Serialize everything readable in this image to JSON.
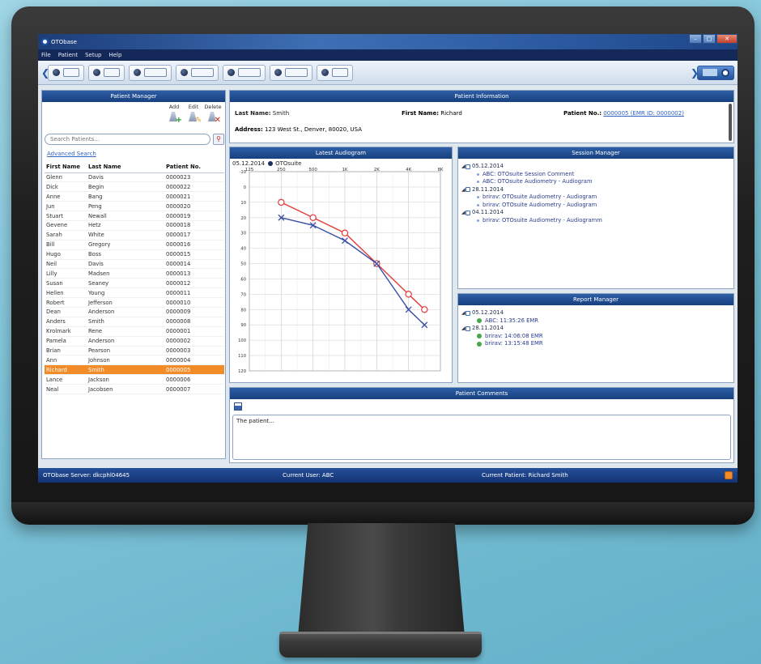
{
  "app": {
    "title": "OTObase"
  },
  "menu": [
    "File",
    "Patient",
    "Setup",
    "Help"
  ],
  "patient_manager": {
    "title": "Patient Manager",
    "actions": [
      "Add",
      "Edit",
      "Delete"
    ],
    "search_placeholder": "Search Patients...",
    "advanced_search": "Advanced Search",
    "columns": [
      "First Name",
      "Last Name",
      "Patient No."
    ],
    "rows": [
      [
        "Glenn",
        "Davis",
        "0000023"
      ],
      [
        "Dick",
        "Begin",
        "0000022"
      ],
      [
        "Anne",
        "Bang",
        "0000021"
      ],
      [
        "Jun",
        "Peng",
        "0000020"
      ],
      [
        "Stuart",
        "Newall",
        "0000019"
      ],
      [
        "Gevene",
        "Hetz",
        "0000018"
      ],
      [
        "Sarah",
        "White",
        "0000017"
      ],
      [
        "Bill",
        "Gregory",
        "0000016"
      ],
      [
        "Hugo",
        "Boss",
        "0000015"
      ],
      [
        "Neil",
        "Davis",
        "0000014"
      ],
      [
        "Lilly",
        "Madsen",
        "0000013"
      ],
      [
        "Susan",
        "Seaney",
        "0000012"
      ],
      [
        "Hellen",
        "Young",
        "0000011"
      ],
      [
        "Robert",
        "Jefferson",
        "0000010"
      ],
      [
        "Dean",
        "Anderson",
        "0000009"
      ],
      [
        "Anders",
        "Smith",
        "0000008"
      ],
      [
        "Krolmark",
        "Rene",
        "0000001"
      ],
      [
        "Pamela",
        "Anderson",
        "0000002"
      ],
      [
        "Brian",
        "Pearson",
        "0000003"
      ],
      [
        "Ann",
        "Johnson",
        "0000004"
      ],
      [
        "Richard",
        "Smith",
        "0000005"
      ],
      [
        "Lance",
        "Jackson",
        "0000006"
      ],
      [
        "Neal",
        "Jacobsen",
        "0000007"
      ]
    ],
    "selected_index": 20
  },
  "patient_info": {
    "title": "Patient Information",
    "last_name_label": "Last Name:",
    "last_name": "Smith",
    "first_name_label": "First Name:",
    "first_name": "Richard",
    "patient_no_label": "Patient No.:",
    "patient_no": "0000005 (EMR ID: 0000002)",
    "address_label": "Address:",
    "address": "123 West St., Denver, 80020, USA"
  },
  "audiogram": {
    "title": "Latest Audiogram",
    "date": "05.12.2014",
    "source": "OTOsuite",
    "freq_labels": [
      "125",
      "250",
      "500",
      "1K",
      "2K",
      "4K",
      "8K"
    ],
    "db_labels": [
      "-10",
      "0",
      "10",
      "20",
      "30",
      "40",
      "50",
      "60",
      "70",
      "80",
      "90",
      "100",
      "110",
      "120"
    ],
    "colors": {
      "right": "#e23b3b",
      "left": "#3a4fa8"
    }
  },
  "chart_data": {
    "type": "line",
    "title": "",
    "xlabel": "",
    "ylabel": "",
    "x": [
      "125",
      "250",
      "500",
      "1K",
      "2K",
      "4K",
      "8K"
    ],
    "ylim": [
      -10,
      120
    ],
    "y_inverted": true,
    "series": [
      {
        "marker": "circle",
        "color": "#e23b3b",
        "points": [
          [
            1,
            10
          ],
          [
            2,
            20
          ],
          [
            3,
            30
          ],
          [
            4,
            50
          ],
          [
            5,
            70
          ],
          [
            5.5,
            80
          ]
        ]
      },
      {
        "marker": "cross",
        "color": "#3a4fa8",
        "points": [
          [
            1,
            20
          ],
          [
            2,
            25
          ],
          [
            3,
            35
          ],
          [
            4,
            50
          ],
          [
            5,
            80
          ],
          [
            5.5,
            90
          ]
        ]
      }
    ]
  },
  "session_manager": {
    "title": "Session Manager",
    "dates": [
      {
        "date": "05.12.2014",
        "items": [
          "ABC: OTOsuite Session Comment",
          "ABC: OTOsuite Audiometry - Audiogram"
        ]
      },
      {
        "date": "28.11.2014",
        "items": [
          "brirav: OTOsuite Audiometry - Audiogram",
          "brirav: OTOsuite Audiometry - Audiogram"
        ]
      },
      {
        "date": "04.11.2014",
        "items": [
          "brirav: OTOsuite Audiometry - Audiogramm"
        ]
      }
    ]
  },
  "report_manager": {
    "title": "Report Manager",
    "dates": [
      {
        "date": "05.12.2014",
        "items": [
          "ABC: 11:35:26 EMR"
        ]
      },
      {
        "date": "28.11.2014",
        "items": [
          "brirav: 14:06:08 EMR",
          "brirav: 13:15:48 EMR"
        ]
      }
    ]
  },
  "comments": {
    "title": "Patient Comments",
    "text": "The patient..."
  },
  "status": {
    "server": "OTObase Server: dkcphl04645",
    "user": "Current User: ABC",
    "patient": "Current Patient: Richard Smith"
  }
}
